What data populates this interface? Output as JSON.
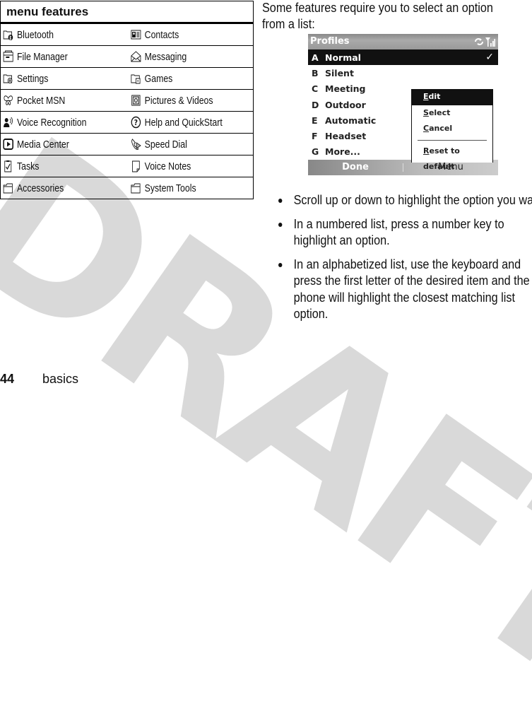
{
  "watermark": "DRAFT",
  "menu_features": {
    "title": "menu features",
    "rows": [
      [
        {
          "icon": "bluetooth-folder-icon",
          "label": "Bluetooth"
        },
        {
          "icon": "contacts-icon",
          "label": "Contacts"
        }
      ],
      [
        {
          "icon": "file-manager-icon",
          "label": "File Manager"
        },
        {
          "icon": "messaging-envelope-icon",
          "label": "Messaging"
        }
      ],
      [
        {
          "icon": "settings-folder-icon",
          "label": "Settings"
        },
        {
          "icon": "games-folder-icon",
          "label": "Games"
        }
      ],
      [
        {
          "icon": "msn-butterfly-icon",
          "label": "Pocket MSN"
        },
        {
          "icon": "pictures-videos-icon",
          "label": "Pictures & Videos"
        }
      ],
      [
        {
          "icon": "voice-recognition-icon",
          "label": "Voice Recognition"
        },
        {
          "icon": "help-question-icon",
          "label": "Help and QuickStart"
        }
      ],
      [
        {
          "icon": "media-center-icon",
          "label": "Media Center"
        },
        {
          "icon": "speed-dial-phone-icon",
          "label": "Speed Dial"
        }
      ],
      [
        {
          "icon": "tasks-clipboard-icon",
          "label": "Tasks"
        },
        {
          "icon": "voice-notes-icon",
          "label": "Voice Notes"
        }
      ],
      [
        {
          "icon": "accessories-folder-icon",
          "label": "Accessories"
        },
        {
          "icon": "system-tools-folder-icon",
          "label": "System Tools"
        }
      ]
    ]
  },
  "intro_text": "Some features require you to select an option from a list:",
  "phone_screen": {
    "title": "Profiles",
    "status_icons": [
      "sync-icon",
      "signal-icon"
    ],
    "items": [
      {
        "key": "A",
        "label": "Normal",
        "selected": true,
        "checked": true
      },
      {
        "key": "B",
        "label": "Silent"
      },
      {
        "key": "C",
        "label": "Meeting"
      },
      {
        "key": "D",
        "label": "Outdoor"
      },
      {
        "key": "E",
        "label": "Automatic"
      },
      {
        "key": "F",
        "label": "Headset"
      },
      {
        "key": "G",
        "label": "More..."
      }
    ],
    "check_mark": "✓",
    "popup_menu": [
      {
        "label": "Edit",
        "accel": "E",
        "active": true
      },
      {
        "label": "Select",
        "accel": "S"
      },
      {
        "label": "Cancel",
        "accel": "C"
      },
      {
        "separator": true
      },
      {
        "label": "Reset to default",
        "accel": "R"
      }
    ],
    "softkeys": {
      "left": "Done",
      "right": "Menu"
    }
  },
  "bullets": [
    "Scroll up or down to highlight the option you want.",
    "In a numbered list, press a number key to highlight an option.",
    "In an alphabetized list, use the keyboard and press the first letter of the desired item and the phone will highlight the closest matching list option."
  ],
  "footer": {
    "page_number": "44",
    "section": "basics"
  }
}
